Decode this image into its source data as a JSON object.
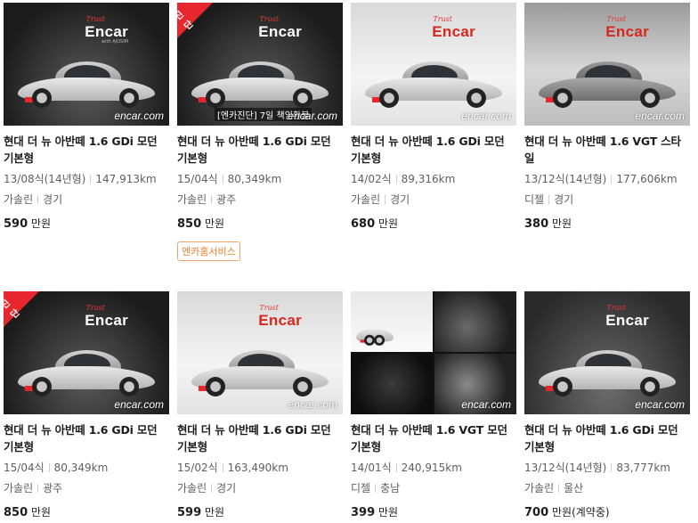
{
  "watermark": "encar.com",
  "brand": {
    "trust": "Trust",
    "name": "Encar",
    "sub": "with AJOSIM"
  },
  "ribbon_label": "진단",
  "unit": "만원",
  "listings": [
    {
      "title": "현대 더 뉴 아반떼 1.6 GDi 모던 기본형",
      "year": "13/08식(14년형)",
      "km": "147,913km",
      "fuel": "가솔린",
      "region": "경기",
      "price": "590",
      "price_note": "",
      "badge": "",
      "caption": "",
      "diagnosis": false
    },
    {
      "title": "현대 더 뉴 아반떼 1.6 GDi 모던 기본형",
      "year": "15/04식",
      "km": "80,349km",
      "fuel": "가솔린",
      "region": "광주",
      "price": "850",
      "price_note": "",
      "badge": "엔카홈서비스",
      "caption": "[엔카진단] 7일 책임환불",
      "diagnosis": true
    },
    {
      "title": "현대 더 뉴 아반떼 1.6 GDi 모던 기본형",
      "year": "14/02식",
      "km": "89,316km",
      "fuel": "가솔린",
      "region": "경기",
      "price": "680",
      "price_note": "",
      "badge": "",
      "caption": "",
      "diagnosis": false
    },
    {
      "title": "현대 더 뉴 아반떼 1.6 VGT 스타일",
      "year": "13/12식(14년형)",
      "km": "177,606km",
      "fuel": "디젤",
      "region": "경기",
      "price": "380",
      "price_note": "",
      "badge": "",
      "caption": "",
      "diagnosis": false
    },
    {
      "title": "현대 더 뉴 아반떼 1.6 GDi 모던 기본형",
      "year": "15/04식",
      "km": "80,349km",
      "fuel": "가솔린",
      "region": "광주",
      "price": "850",
      "price_note": "",
      "badge": "",
      "caption": "",
      "diagnosis": true
    },
    {
      "title": "현대 더 뉴 아반떼 1.6 GDi 모던 기본형",
      "year": "15/02식",
      "km": "163,490km",
      "fuel": "가솔린",
      "region": "경기",
      "price": "599",
      "price_note": "",
      "badge": "",
      "caption": "",
      "diagnosis": false
    },
    {
      "title": "현대 더 뉴 아반떼 1.6 VGT 모던 기본형",
      "year": "14/01식",
      "km": "240,915km",
      "fuel": "디젤",
      "region": "충남",
      "price": "399",
      "price_note": "",
      "badge": "",
      "caption": "",
      "diagnosis": false
    },
    {
      "title": "현대 더 뉴 아반떼 1.6 GDi 모던 기본형",
      "year": "13/12식(14년형)",
      "km": "83,777km",
      "fuel": "가솔린",
      "region": "울산",
      "price": "700",
      "price_note": "(계약중)",
      "badge": "",
      "caption": "",
      "diagnosis": false
    }
  ]
}
